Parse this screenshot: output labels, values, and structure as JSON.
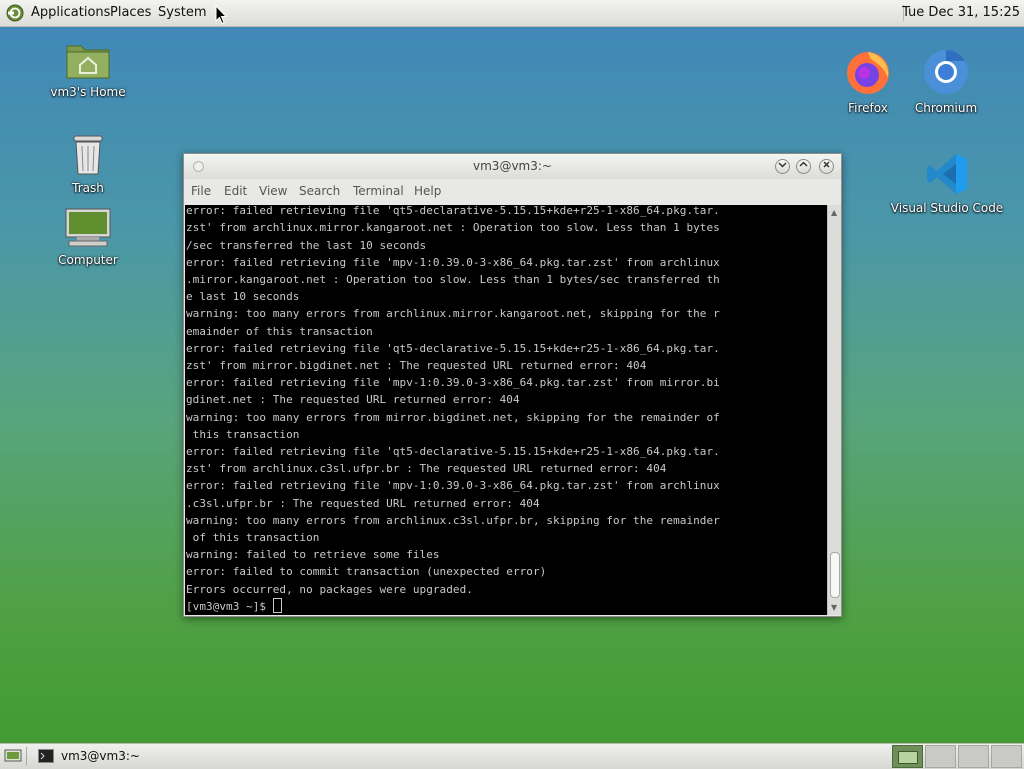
{
  "top_panel": {
    "menus": [
      "Applications",
      "Places",
      "System"
    ],
    "clock": "Tue Dec 31, 15:25"
  },
  "desktop": {
    "left_icons": [
      {
        "label": "vm3's Home",
        "icon": "home-folder-icon"
      },
      {
        "label": "Trash",
        "icon": "trash-icon"
      },
      {
        "label": "Computer",
        "icon": "computer-icon"
      }
    ],
    "right_icons": [
      {
        "label": "Firefox",
        "icon": "firefox-icon"
      },
      {
        "label": "Chromium",
        "icon": "chromium-icon"
      },
      {
        "label": "Visual Studio Code",
        "icon": "vscode-icon"
      }
    ]
  },
  "terminal": {
    "title": "vm3@vm3:~",
    "menu": [
      "File",
      "Edit",
      "View",
      "Search",
      "Terminal",
      "Help"
    ],
    "lines": [
      "error: failed retrieving file 'qt5-declarative-5.15.15+kde+r25-1-x86_64.pkg.tar.",
      "zst' from archlinux.mirror.kangaroot.net : Operation too slow. Less than 1 bytes",
      "/sec transferred the last 10 seconds",
      "error: failed retrieving file 'mpv-1:0.39.0-3-x86_64.pkg.tar.zst' from archlinux",
      ".mirror.kangaroot.net : Operation too slow. Less than 1 bytes/sec transferred th",
      "e last 10 seconds",
      "warning: too many errors from archlinux.mirror.kangaroot.net, skipping for the r",
      "emainder of this transaction",
      "error: failed retrieving file 'qt5-declarative-5.15.15+kde+r25-1-x86_64.pkg.tar.",
      "zst' from mirror.bigdinet.net : The requested URL returned error: 404",
      "error: failed retrieving file 'mpv-1:0.39.0-3-x86_64.pkg.tar.zst' from mirror.bi",
      "gdinet.net : The requested URL returned error: 404",
      "warning: too many errors from mirror.bigdinet.net, skipping for the remainder of",
      " this transaction",
      "error: failed retrieving file 'qt5-declarative-5.15.15+kde+r25-1-x86_64.pkg.tar.",
      "zst' from archlinux.c3sl.ufpr.br : The requested URL returned error: 404",
      "error: failed retrieving file 'mpv-1:0.39.0-3-x86_64.pkg.tar.zst' from archlinux",
      ".c3sl.ufpr.br : The requested URL returned error: 404",
      "warning: too many errors from archlinux.c3sl.ufpr.br, skipping for the remainder",
      " of this transaction",
      "warning: failed to retrieve some files",
      "error: failed to commit transaction (unexpected error)",
      "Errors occurred, no packages were upgraded."
    ],
    "prompt": "[vm3@vm3 ~]$ "
  },
  "bottom_panel": {
    "task_label": "vm3@vm3:~"
  }
}
